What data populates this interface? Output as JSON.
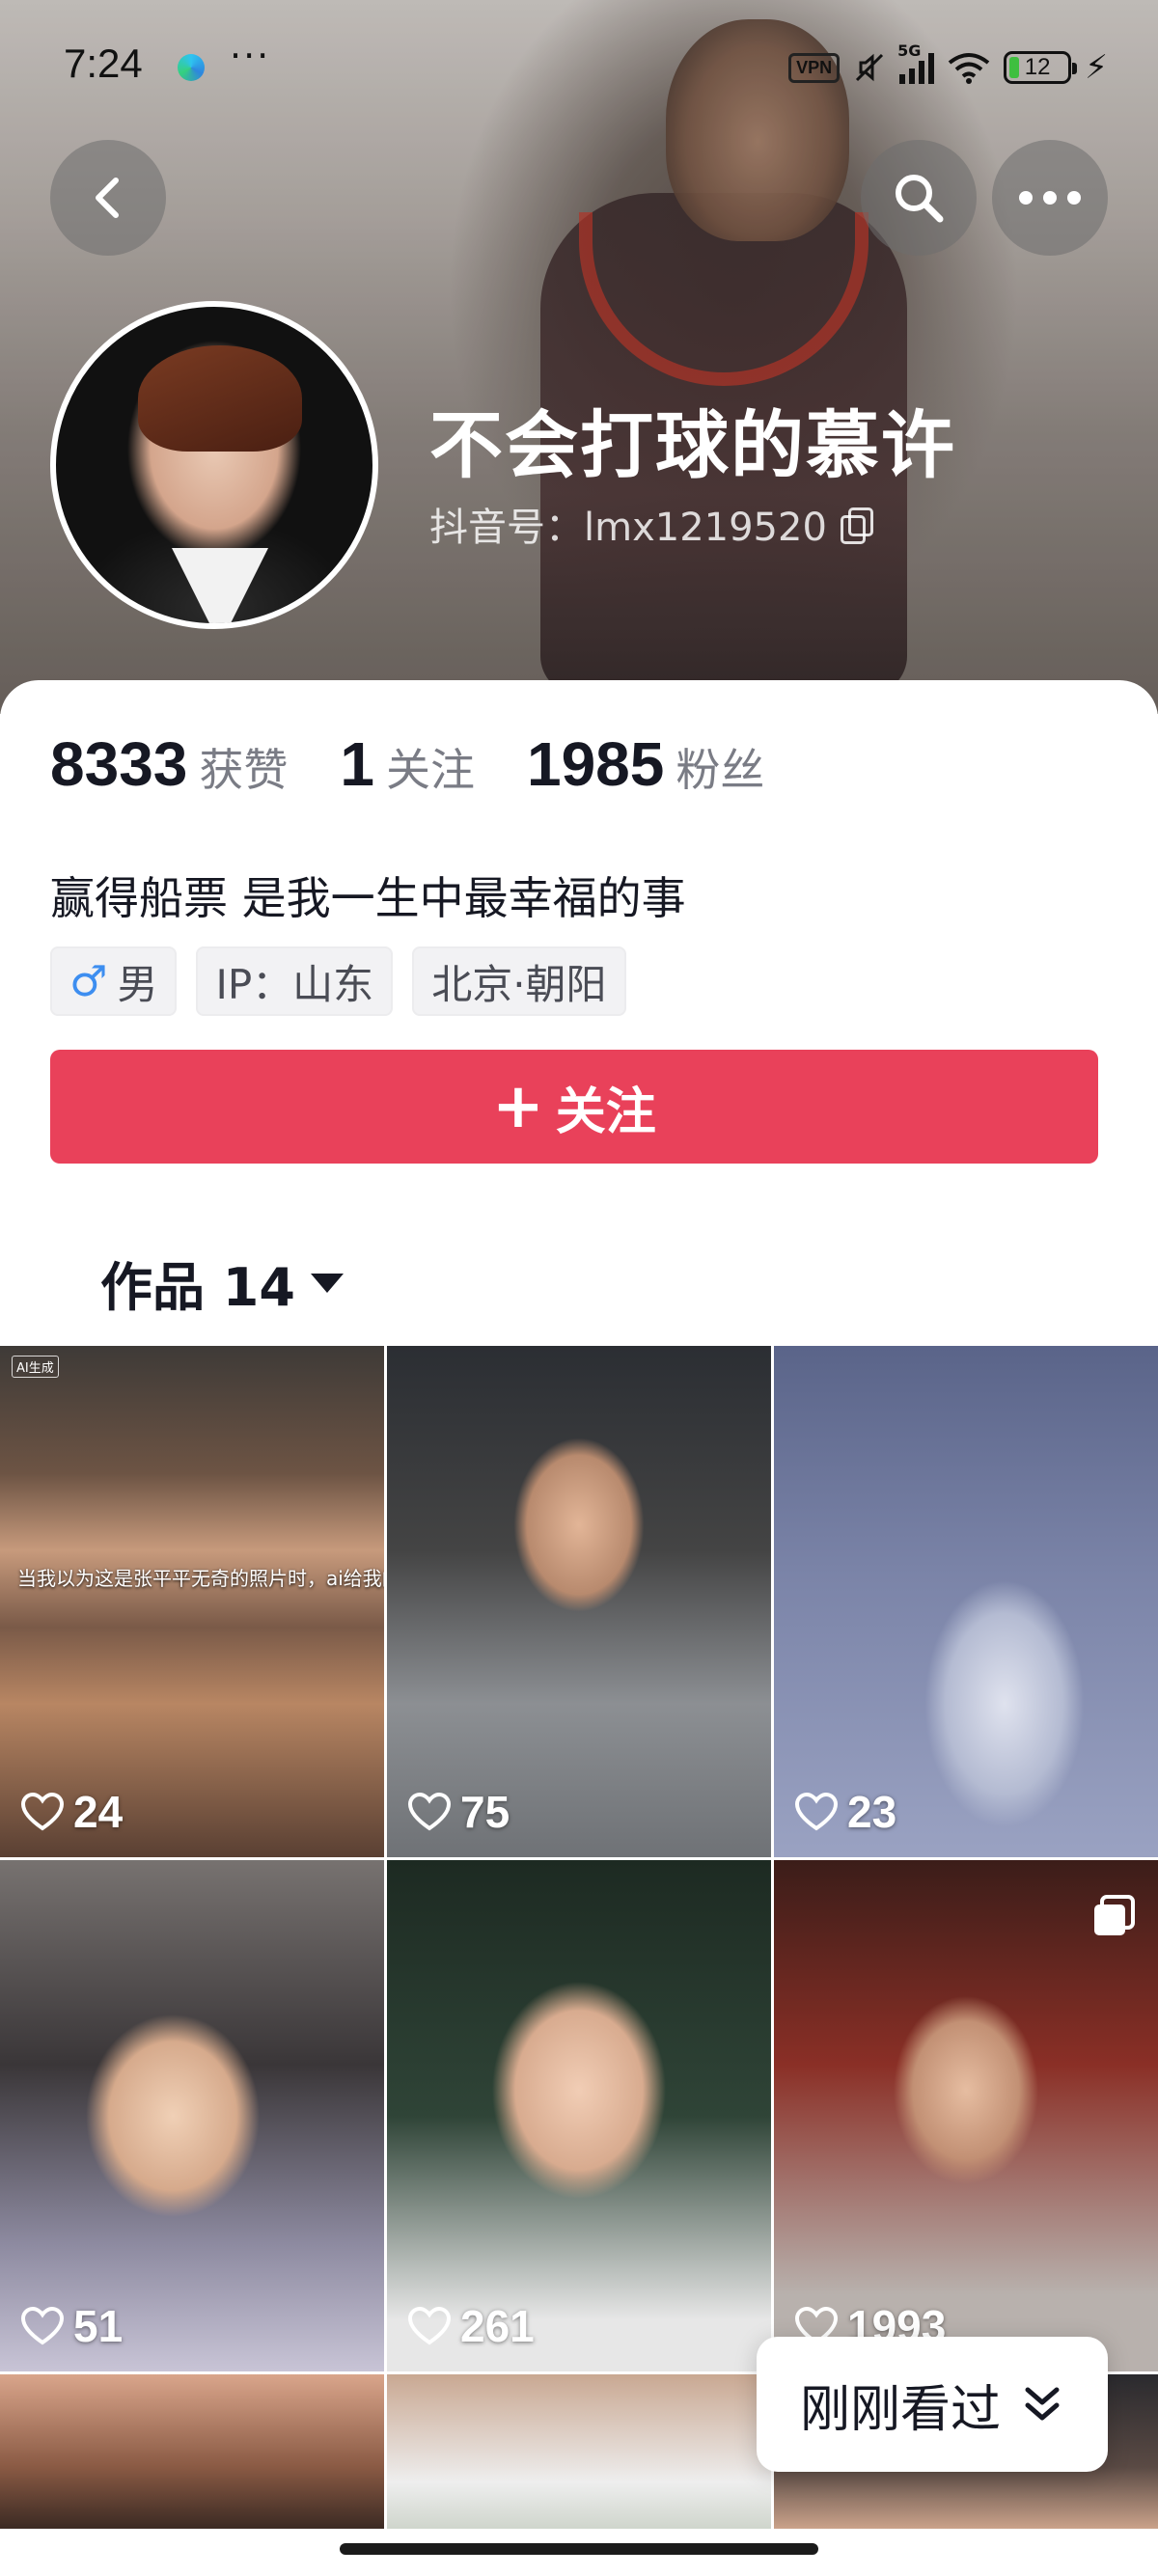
{
  "status_bar": {
    "time": "7:24",
    "more": "···",
    "vpn": "VPN",
    "network": "5G",
    "battery": "12",
    "icons": [
      "app-icon",
      "vpn-icon",
      "mute-icon",
      "signal-icon",
      "wifi-icon",
      "battery-icon",
      "charging-icon"
    ]
  },
  "header": {
    "back_icon": "chevron-left-icon",
    "search_icon": "search-icon",
    "more_icon": "more-horizontal-icon"
  },
  "profile": {
    "username": "不会打球的慕许",
    "douyin_id": "抖音号：lmx1219520",
    "copy_icon": "copy-icon",
    "stats": [
      {
        "num": "8333",
        "label": "获赞"
      },
      {
        "num": "1",
        "label": "关注"
      },
      {
        "num": "1985",
        "label": "粉丝"
      }
    ],
    "bio": "赢得船票 是我一生中最幸福的事",
    "tags": {
      "gender_symbol": "♂",
      "gender": "男",
      "ip": "IP：山东",
      "location": "北京·朝阳"
    },
    "follow_label": "关注",
    "follow_color": "#e9415a"
  },
  "works": {
    "tab_label": "作品 14",
    "items": [
      {
        "likes": "24",
        "caption": "当我以为这是张平平无奇的照片时，ai给我的：",
        "badge": "AI生成"
      },
      {
        "likes": "75"
      },
      {
        "likes": "23"
      },
      {
        "likes": "51"
      },
      {
        "likes": "261"
      },
      {
        "likes": "1993"
      },
      {
        "likes": ""
      },
      {
        "likes": ""
      },
      {
        "likes": ""
      }
    ]
  },
  "recent_pill": {
    "label": "刚刚看过"
  }
}
